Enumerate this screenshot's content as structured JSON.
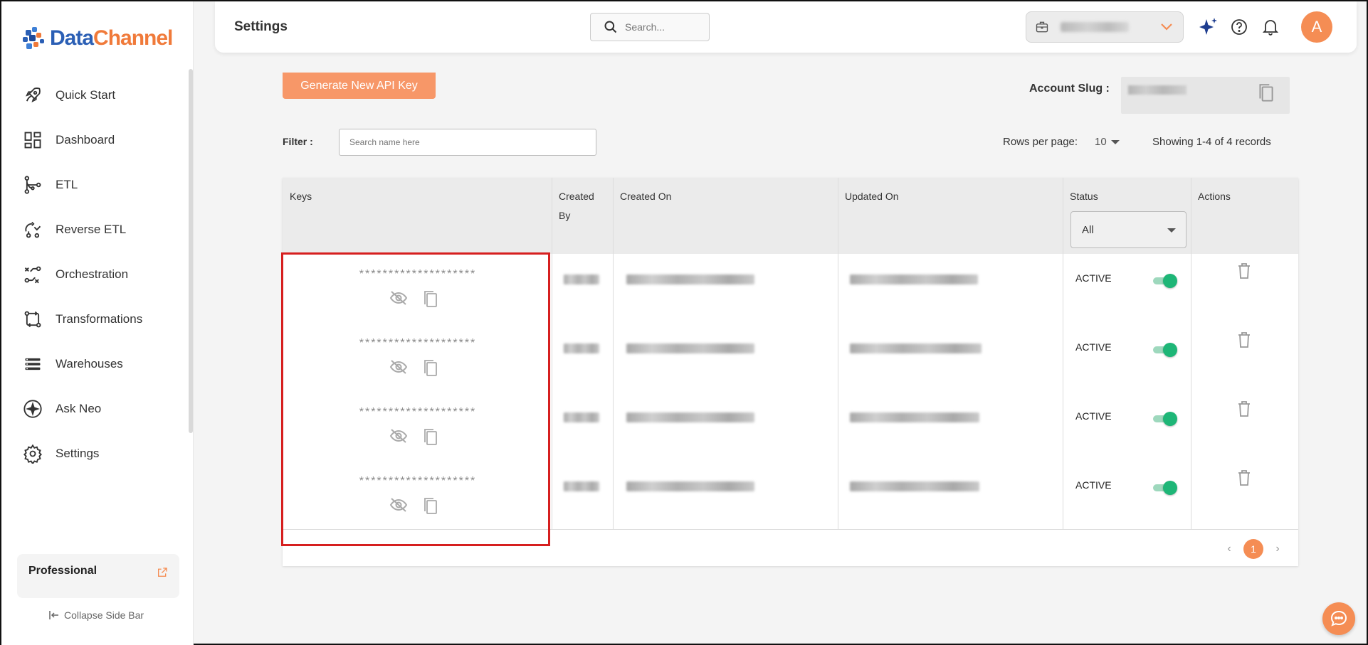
{
  "sidebar": {
    "brand": {
      "part1": "Data",
      "part2": "Channel"
    },
    "items": [
      {
        "label": "Quick Start",
        "icon": "rocket-icon"
      },
      {
        "label": "Dashboard",
        "icon": "dashboard-grid-icon"
      },
      {
        "label": "ETL",
        "icon": "etl-branch-icon"
      },
      {
        "label": "Reverse ETL",
        "icon": "reverse-etl-icon"
      },
      {
        "label": "Orchestration",
        "icon": "orchestration-icon"
      },
      {
        "label": "Transformations",
        "icon": "transform-icon"
      },
      {
        "label": "Warehouses",
        "icon": "warehouse-stack-icon"
      },
      {
        "label": "Ask Neo",
        "icon": "sparkle-icon"
      },
      {
        "label": "Settings",
        "icon": "gear-icon"
      }
    ],
    "plan": "Professional",
    "collapse_label": "Collapse Side Bar"
  },
  "header": {
    "title": "Settings",
    "search_placeholder": "Search...",
    "avatar_initial": "A"
  },
  "toolbar": {
    "generate_label": "Generate New API Key",
    "account_slug_label": "Account Slug :",
    "filter_label": "Filter :",
    "filter_placeholder": "Search name here",
    "rows_per_page_label": "Rows per page:",
    "rows_per_page_value": "10",
    "showing_text": "Showing 1-4 of 4 records"
  },
  "table": {
    "headers": {
      "keys": "Keys",
      "created_by_1": "Created",
      "created_by_2": "By",
      "created_on": "Created On",
      "updated_on": "Updated On",
      "status": "Status",
      "actions": "Actions"
    },
    "status_filter": "All",
    "rows": [
      {
        "key_mask": "********************",
        "status": "ACTIVE",
        "enabled": true
      },
      {
        "key_mask": "********************",
        "status": "ACTIVE",
        "enabled": true
      },
      {
        "key_mask": "********************",
        "status": "ACTIVE",
        "enabled": true
      },
      {
        "key_mask": "********************",
        "status": "ACTIVE",
        "enabled": true
      }
    ],
    "pagination": {
      "current": "1",
      "prev": "‹",
      "next": "›"
    }
  },
  "colors": {
    "accent": "#f58d54",
    "toggle_on": "#1eb677",
    "highlight": "#d61f1f",
    "brand_blue": "#2b5fb5"
  }
}
